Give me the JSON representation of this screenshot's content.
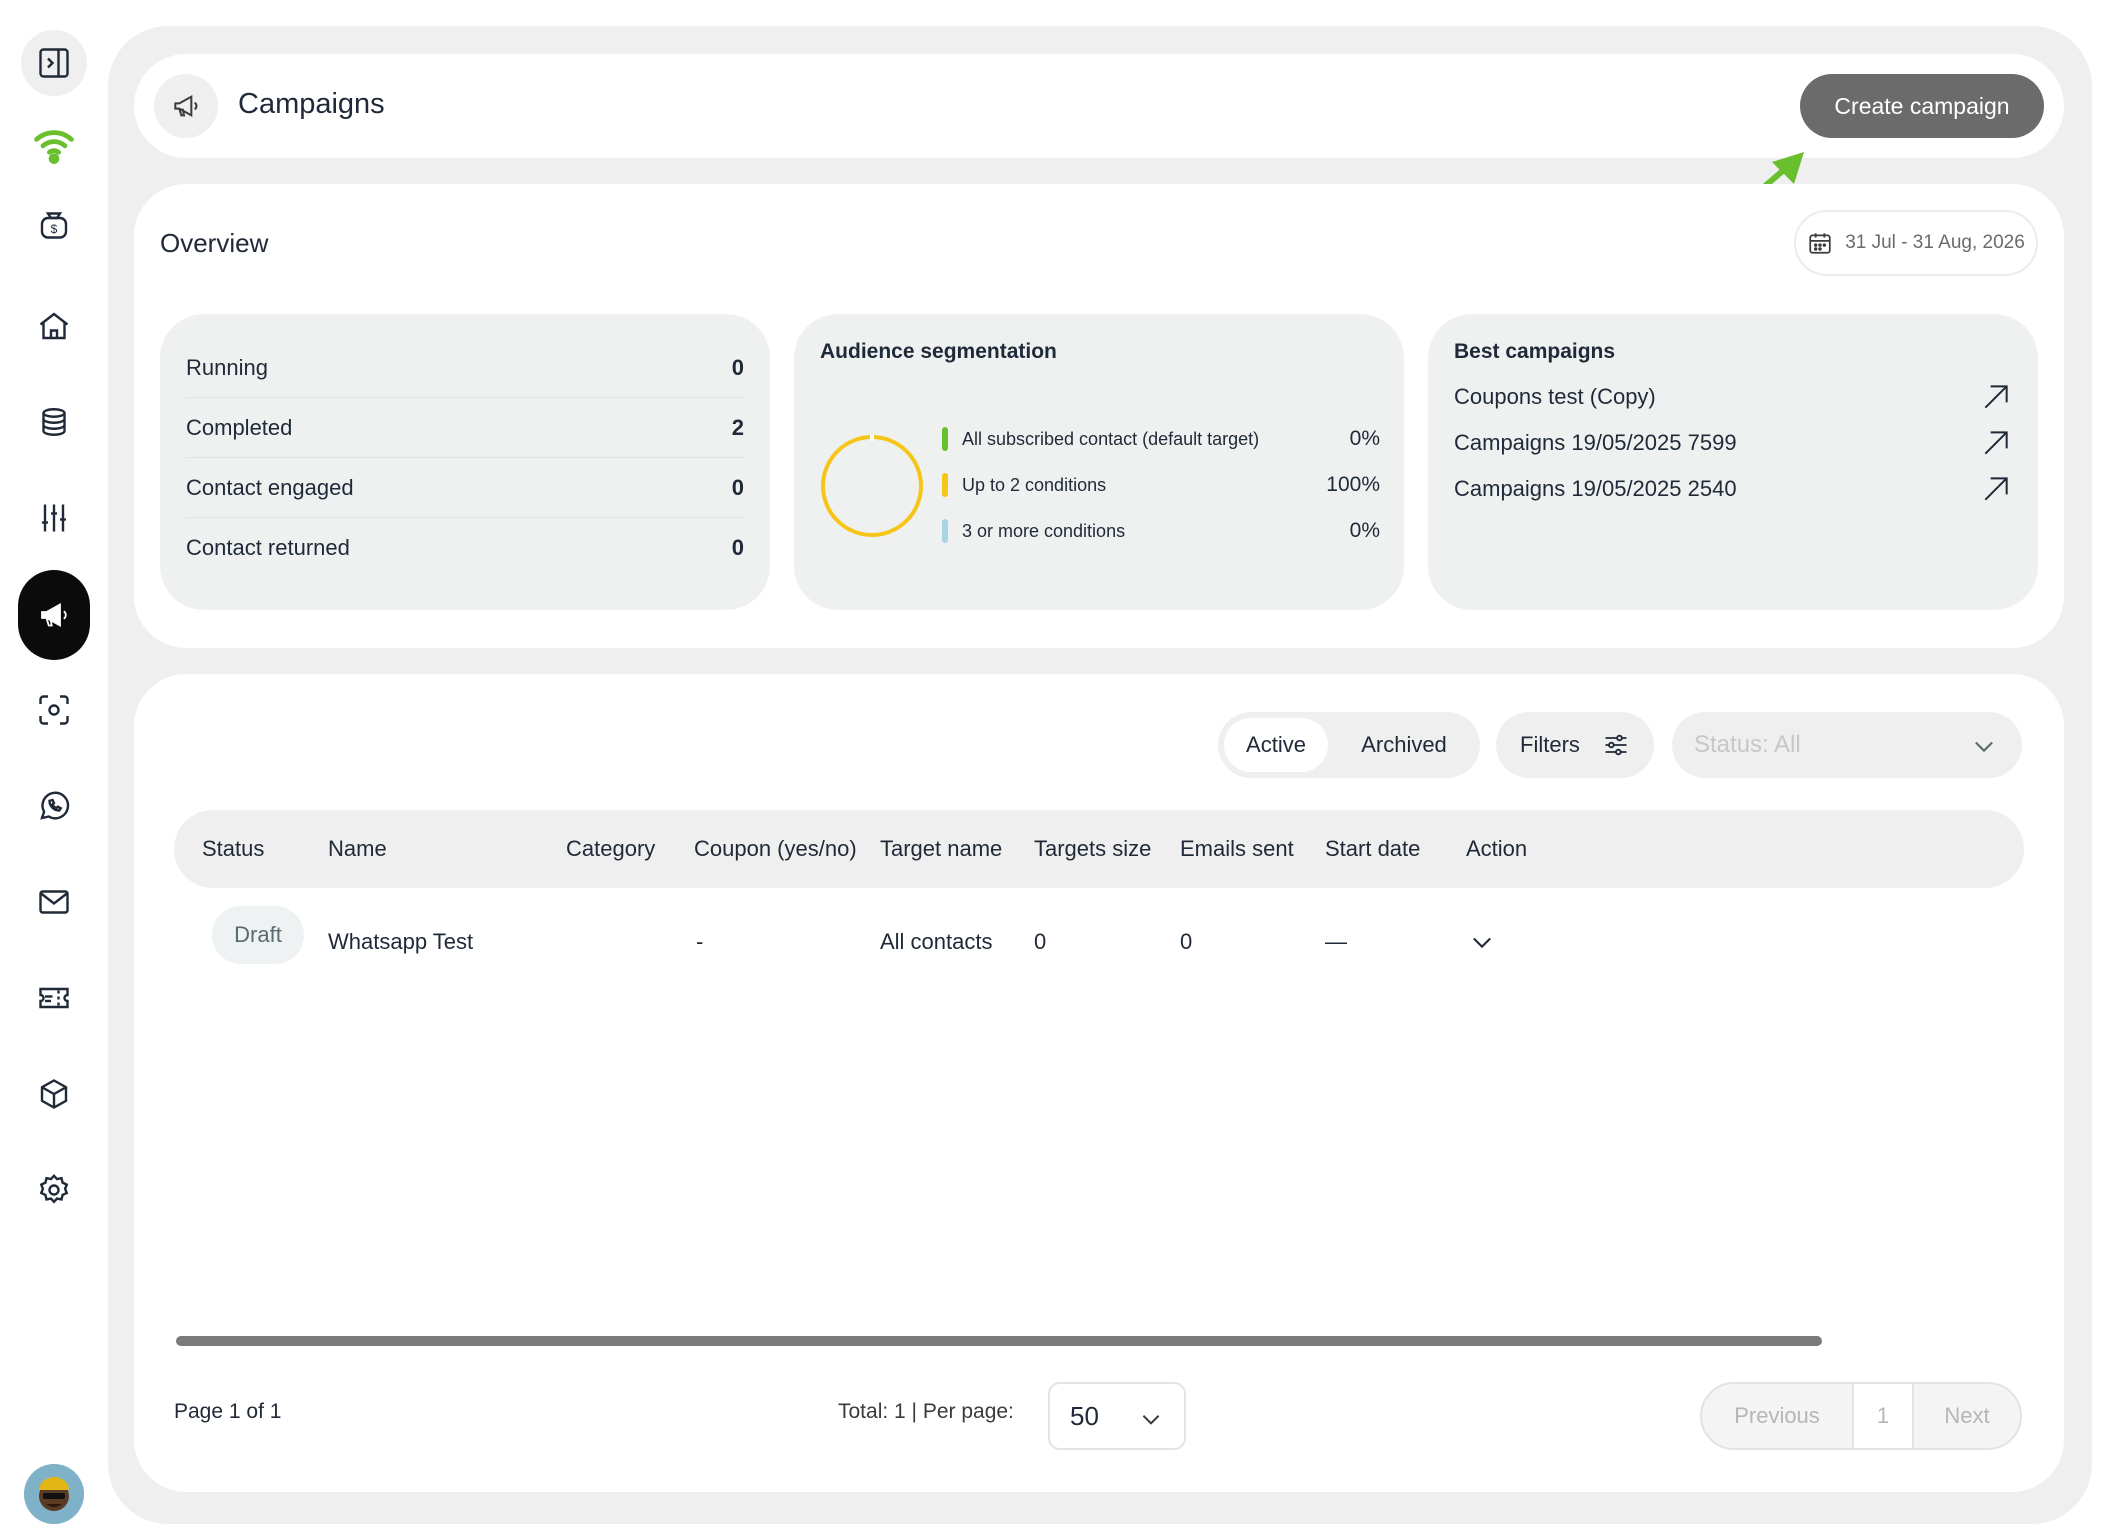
{
  "sidebar": {
    "items": [
      {
        "name": "panel-toggle-icon"
      },
      {
        "name": "wifi-logo-icon",
        "color": "#6abf2e"
      },
      {
        "name": "money-bag-icon"
      },
      {
        "name": "home-icon"
      },
      {
        "name": "database-icon"
      },
      {
        "name": "sliders-icon"
      },
      {
        "name": "megaphone-icon",
        "active": true
      },
      {
        "name": "face-scan-icon"
      },
      {
        "name": "whatsapp-icon"
      },
      {
        "name": "mail-icon"
      },
      {
        "name": "ticket-icon"
      },
      {
        "name": "cube-icon"
      },
      {
        "name": "settings-icon"
      }
    ]
  },
  "header": {
    "title": "Campaigns",
    "create_label": "Create campaign"
  },
  "overview": {
    "title": "Overview",
    "date_range": "31 Jul - 31 Aug, 2026",
    "stats": [
      {
        "label": "Running",
        "value": "0"
      },
      {
        "label": "Completed",
        "value": "2"
      },
      {
        "label": "Contact engaged",
        "value": "0"
      },
      {
        "label": "Contact returned",
        "value": "0"
      }
    ],
    "audience": {
      "title": "Audience segmentation",
      "segments": [
        {
          "label": "All subscribed contact (default target)",
          "value": "0%",
          "color": "#6abf2e"
        },
        {
          "label": "Up to 2 conditions",
          "value": "100%",
          "color": "#f5c518"
        },
        {
          "label": "3 or more conditions",
          "value": "0%",
          "color": "#a9d4e8"
        }
      ]
    },
    "best": {
      "title": "Best campaigns",
      "items": [
        {
          "label": "Coupons test (Copy)"
        },
        {
          "label": "Campaigns 19/05/2025 7599"
        },
        {
          "label": "Campaigns 19/05/2025 2540"
        }
      ]
    }
  },
  "toolbar": {
    "tabs": [
      "Active",
      "Archived"
    ],
    "filters_label": "Filters",
    "status_placeholder": "Status: All"
  },
  "table": {
    "columns": [
      "Status",
      "Name",
      "Category",
      "Coupon (yes/no)",
      "Target name",
      "Targets size",
      "Emails sent",
      "Start date",
      "Action"
    ],
    "rows": [
      {
        "status": "Draft",
        "name": "Whatsapp Test",
        "category": "",
        "coupon": "-",
        "target_name": "All contacts",
        "targets_size": "0",
        "emails_sent": "0",
        "start_date": "—"
      }
    ]
  },
  "pagination": {
    "page_label": "Page 1 of 1",
    "total_label": "Total: 1  |  Per page:",
    "per_page": "50",
    "prev_label": "Previous",
    "current": "1",
    "next_label": "Next"
  },
  "colors": {
    "accent_green": "#6abf2e",
    "button_gray": "#6b6b6b"
  }
}
